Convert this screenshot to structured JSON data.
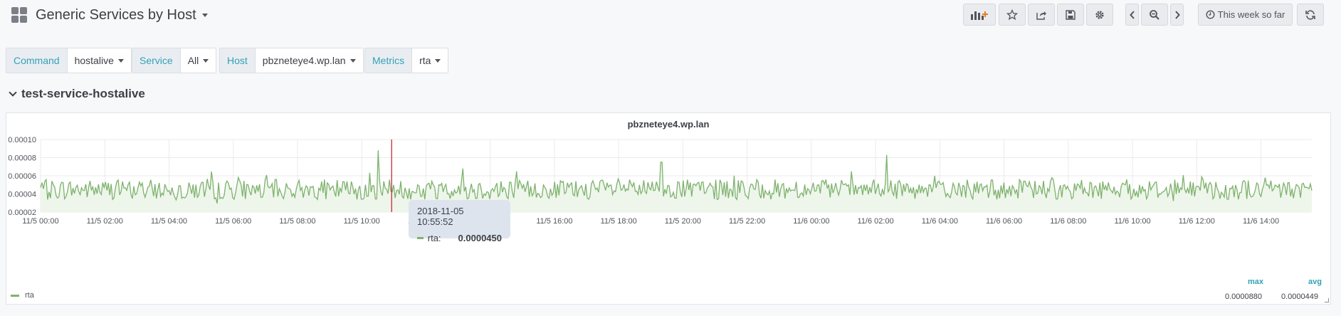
{
  "dashboard": {
    "title": "Generic Services by Host"
  },
  "toolbar": {
    "time_range_label": "This week so far"
  },
  "variables": [
    {
      "label": "Command",
      "value": "hostalive"
    },
    {
      "label": "Service",
      "value": "All"
    },
    {
      "label": "Host",
      "value": "pbzneteye4.wp.lan"
    },
    {
      "label": "Metrics",
      "value": "rta"
    }
  ],
  "row": {
    "title": "test-service-hostalive"
  },
  "panel": {
    "title": "pbzneteye4.wp.lan",
    "legend": {
      "series": "rta",
      "max_header": "max",
      "avg_header": "avg",
      "max_value": "0.0000880",
      "avg_value": "0.0000449"
    },
    "tooltip": {
      "time": "2018-11-05 10:55:52",
      "series": "rta:",
      "value": "0.0000450"
    }
  },
  "colors": {
    "series": "#7eb26d",
    "fill": "#eef6eb",
    "crosshair": "#c4162a",
    "accent": "#33a2b5"
  },
  "chart_data": {
    "type": "area",
    "title": "pbzneteye4.wp.lan",
    "xlabel": "",
    "ylabel": "",
    "ylim": [
      2e-05,
      0.0001
    ],
    "yticks": [
      "0.00002",
      "0.00004",
      "0.00006",
      "0.00008",
      "0.00010"
    ],
    "x_tick_labels": [
      "11/5 00:00",
      "11/5 02:00",
      "11/5 04:00",
      "11/5 06:00",
      "11/5 08:00",
      "11/5 10:00",
      "11/5 12:00",
      "11/5 14:00",
      "11/5 16:00",
      "11/5 18:00",
      "11/5 20:00",
      "11/5 22:00",
      "11/6 00:00",
      "11/6 02:00",
      "11/6 04:00",
      "11/6 06:00",
      "11/6 08:00",
      "11/6 10:00",
      "11/6 12:00",
      "11/6 14:00"
    ],
    "x_range": [
      "2018-11-05 00:00",
      "2018-11-06 15:35"
    ],
    "grid": true,
    "legend_position": "bottom",
    "series": [
      {
        "name": "rta",
        "max": 8.8e-05,
        "avg": 4.49e-05,
        "samples": [
          {
            "x": "2018-11-05 00:00",
            "y": 4.5e-05
          },
          {
            "x": "2018-11-05 02:00",
            "y": 4.7e-05
          },
          {
            "x": "2018-11-05 04:00",
            "y": 4.5e-05
          },
          {
            "x": "2018-11-05 06:00",
            "y": 4.6e-05
          },
          {
            "x": "2018-11-05 08:00",
            "y": 4.6e-05
          },
          {
            "x": "2018-11-05 10:30",
            "y": 8.8e-05
          },
          {
            "x": "2018-11-05 10:55",
            "y": 4.5e-05
          },
          {
            "x": "2018-11-05 13:10",
            "y": 6.8e-05
          },
          {
            "x": "2018-11-05 14:00",
            "y": 4.4e-05
          },
          {
            "x": "2018-11-05 16:00",
            "y": 4.5e-05
          },
          {
            "x": "2018-11-05 18:00",
            "y": 4.7e-05
          },
          {
            "x": "2018-11-05 19:20",
            "y": 7.5e-05
          },
          {
            "x": "2018-11-05 20:00",
            "y": 4.5e-05
          },
          {
            "x": "2018-11-05 22:00",
            "y": 4.5e-05
          },
          {
            "x": "2018-11-06 00:00",
            "y": 4.6e-05
          },
          {
            "x": "2018-11-06 02:20",
            "y": 8.3e-05
          },
          {
            "x": "2018-11-06 04:00",
            "y": 4.6e-05
          },
          {
            "x": "2018-11-06 06:00",
            "y": 4.5e-05
          },
          {
            "x": "2018-11-06 08:00",
            "y": 4.5e-05
          },
          {
            "x": "2018-11-06 10:00",
            "y": 4.5e-05
          },
          {
            "x": "2018-11-06 12:00",
            "y": 4.5e-05
          },
          {
            "x": "2018-11-06 14:00",
            "y": 4.6e-05
          },
          {
            "x": "2018-11-06 15:35",
            "y": 4.8e-05
          }
        ]
      }
    ],
    "crosshair_x": "2018-11-05 10:55:52"
  }
}
